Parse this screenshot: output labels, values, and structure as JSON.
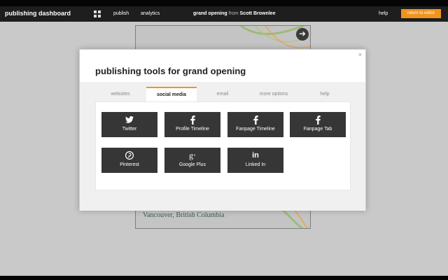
{
  "topbar": {
    "brand": "publishing dashboard",
    "nav": [
      "publish",
      "analytics"
    ],
    "doc_title": "grand opening",
    "doc_from": "from",
    "doc_author": "Scott Brownlee",
    "help": "help",
    "return_button": "return to editor"
  },
  "background_page": {
    "location_text": "Vancouver, British Columbia"
  },
  "modal": {
    "title": "publishing tools for grand opening",
    "close_glyph": "×",
    "tabs": [
      {
        "label": "websites",
        "active": false
      },
      {
        "label": "social media",
        "active": true
      },
      {
        "label": "email",
        "active": false
      },
      {
        "label": "more options",
        "active": false
      },
      {
        "label": "help",
        "active": false
      }
    ],
    "tiles": [
      {
        "label": "Twitter",
        "icon": "twitter-icon"
      },
      {
        "label": "Profile Timeline",
        "icon": "facebook-icon"
      },
      {
        "label": "Fanpage Timeline",
        "icon": "facebook-icon"
      },
      {
        "label": "Fanpage Tab",
        "icon": "facebook-icon"
      },
      {
        "label": "Pinterest",
        "icon": "pinterest-icon"
      },
      {
        "label": "Google Plus",
        "icon": "google-plus-icon"
      },
      {
        "label": "Linked In",
        "icon": "linkedin-icon"
      }
    ]
  },
  "colors": {
    "accent": "#f0941f",
    "tile_bg": "#363636",
    "topbar_bg": "#1e1e1e"
  }
}
